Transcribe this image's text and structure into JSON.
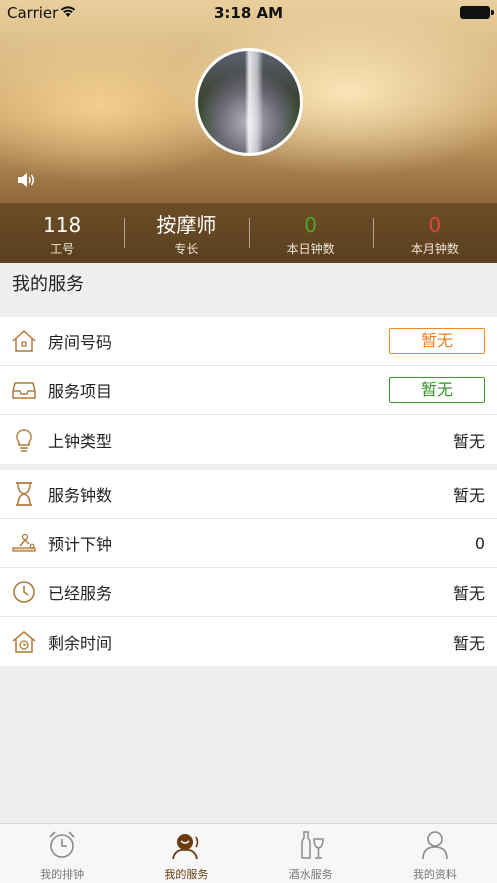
{
  "status_bar": {
    "carrier": "Carrier",
    "time": "3:18 AM"
  },
  "profile": {
    "stats": [
      {
        "value": "118",
        "label": "工号"
      },
      {
        "value": "按摩师",
        "label": "专长"
      },
      {
        "value": "0",
        "label": "本日钟数",
        "color": "#4ea626"
      },
      {
        "value": "0",
        "label": "本月钟数",
        "color": "#e0453a"
      }
    ]
  },
  "section_title": "我的服务",
  "group1": [
    {
      "label": "房间号码",
      "value": "暂无",
      "style": "orange-tag",
      "icon": "house-icon"
    },
    {
      "label": "服务项目",
      "value": "暂无",
      "style": "green-tag",
      "icon": "tray-icon"
    },
    {
      "label": "上钟类型",
      "value": "暂无",
      "style": "plain",
      "icon": "lightbulb-icon"
    }
  ],
  "group2": [
    {
      "label": "服务钟数",
      "value": "暂无",
      "icon": "hourglass-icon"
    },
    {
      "label": "预计下钟",
      "value": "0",
      "icon": "massage-icon"
    },
    {
      "label": "已经服务",
      "value": "暂无",
      "icon": "clock-icon"
    },
    {
      "label": "剩余时间",
      "value": "暂无",
      "icon": "house-clock-icon"
    }
  ],
  "tabs": [
    {
      "label": "我的排钟",
      "icon": "alarm-clock-icon",
      "active": false
    },
    {
      "label": "我的服务",
      "icon": "service-icon",
      "active": true
    },
    {
      "label": "酒水服务",
      "icon": "wine-icon",
      "active": false
    },
    {
      "label": "我的资料",
      "icon": "person-icon",
      "active": false
    }
  ],
  "colors": {
    "accent": "#6b3b10",
    "orange": "#f08a2a",
    "green": "#3e9a2a",
    "red": "#e0453a"
  }
}
